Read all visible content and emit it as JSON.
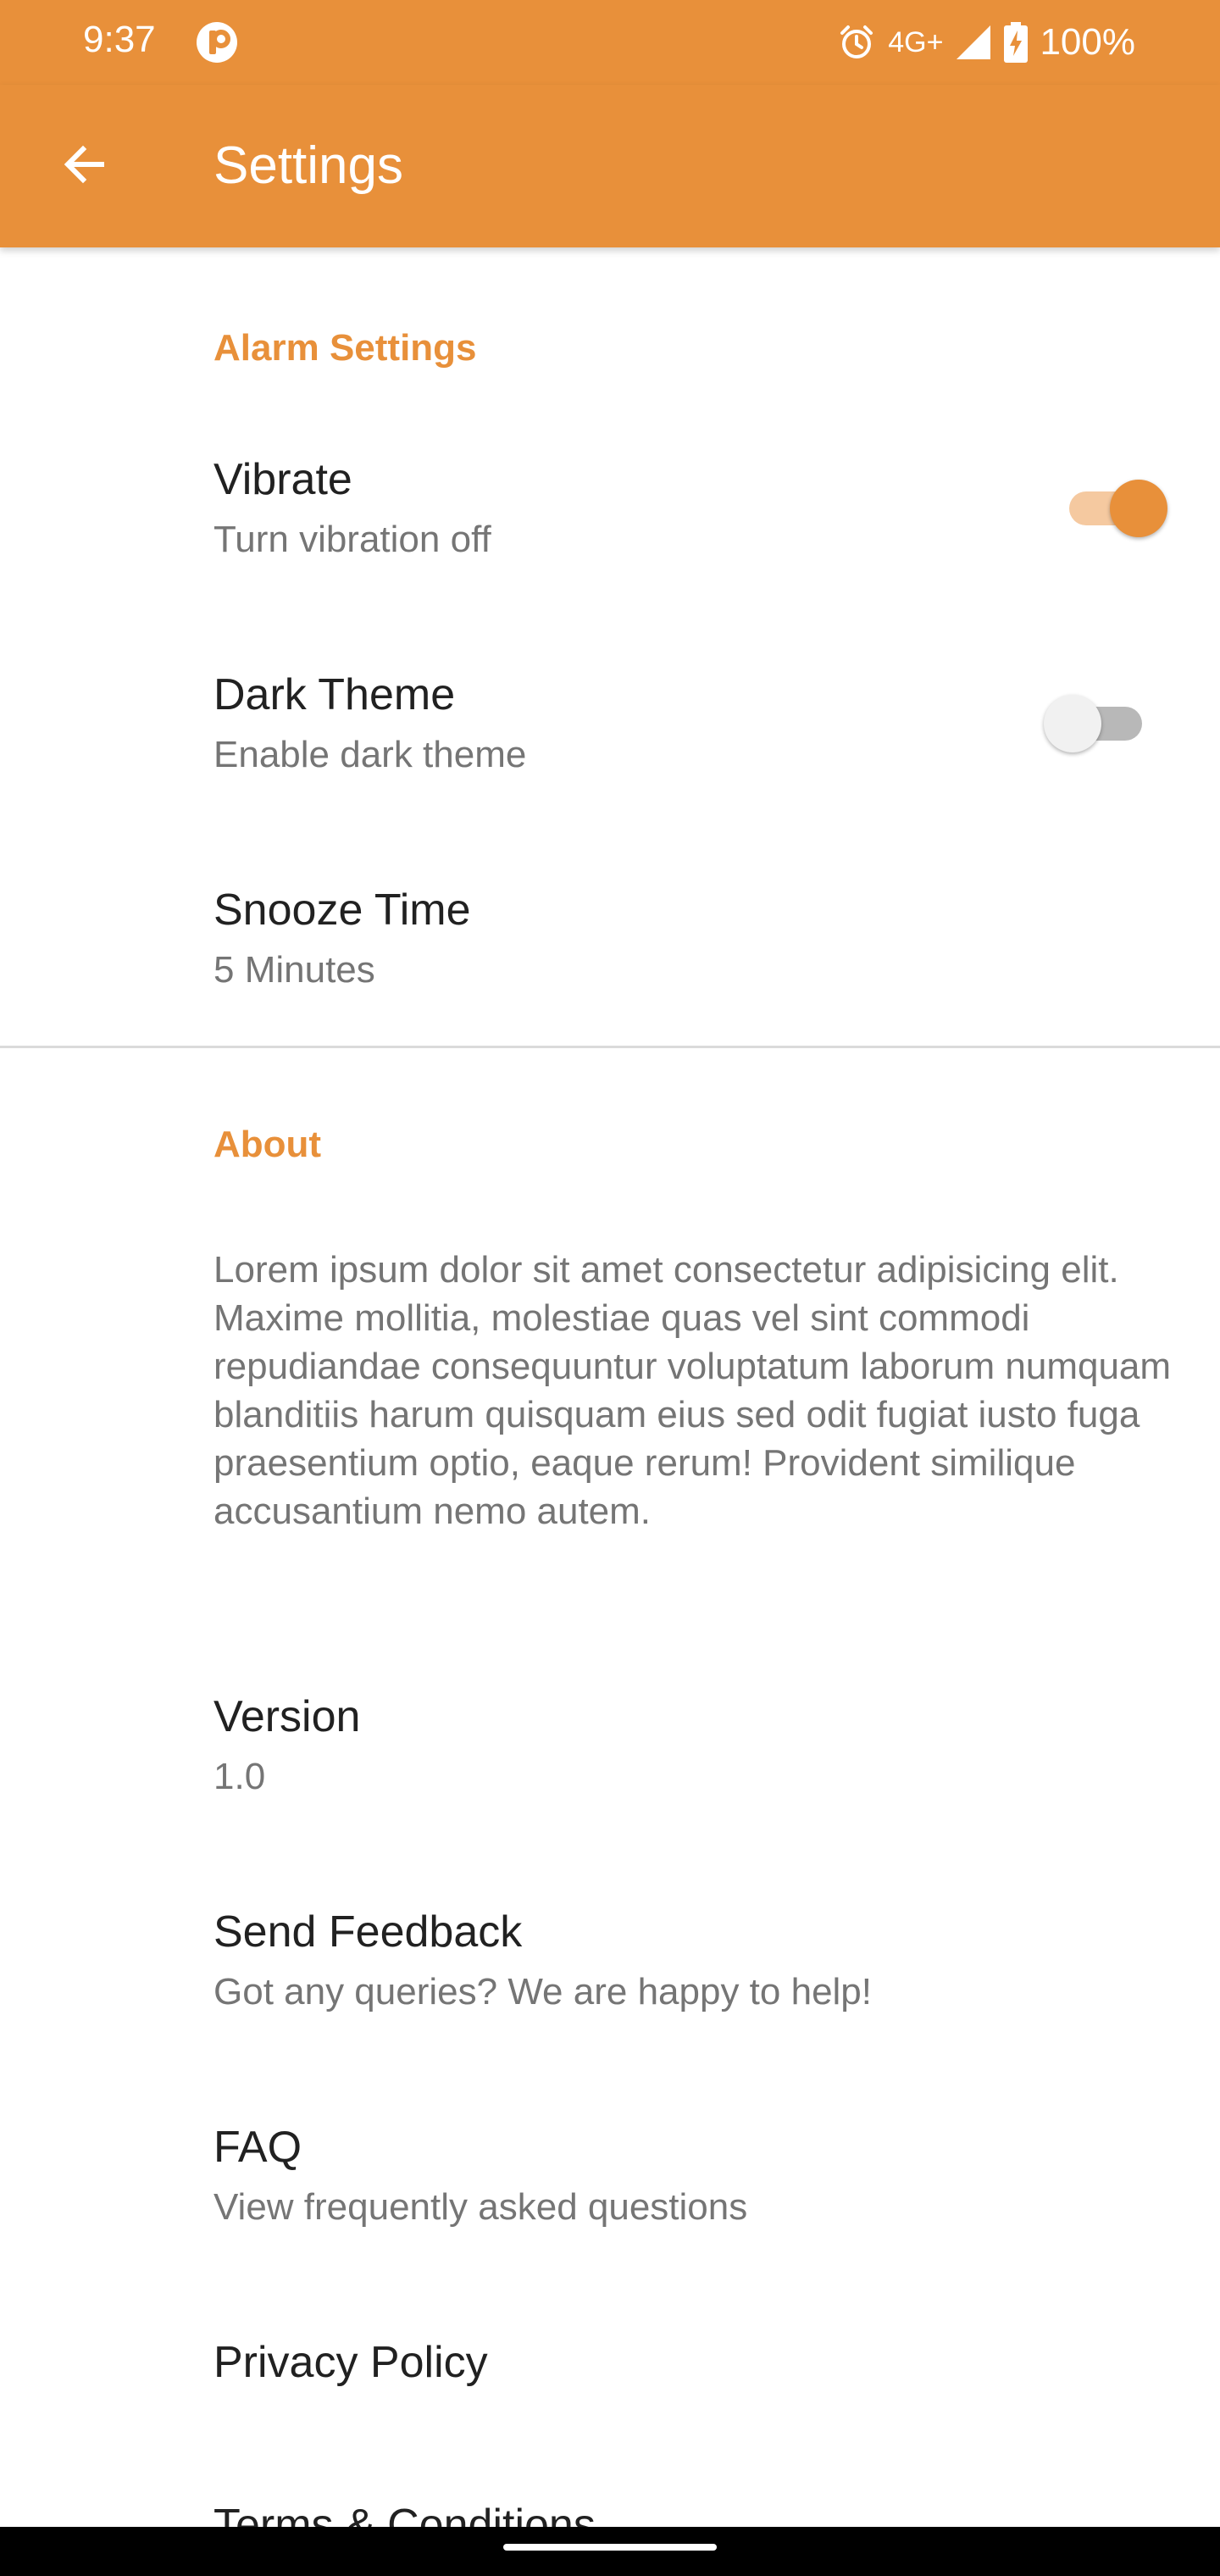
{
  "status_bar": {
    "time": "9:37",
    "network": "4G+",
    "battery": "100%",
    "icons": [
      "app-notification-icon",
      "alarm-icon",
      "signal-icon",
      "battery-charging-icon"
    ]
  },
  "app_bar": {
    "title": "Settings",
    "back_icon": "arrow-back-icon",
    "color": "#E8903A"
  },
  "alarm_section": {
    "title": "Alarm Settings",
    "vibrate": {
      "title": "Vibrate",
      "summary": "Turn vibration off",
      "enabled": true
    },
    "dark_theme": {
      "title": "Dark Theme",
      "summary": "Enable dark theme",
      "enabled": false
    },
    "snooze": {
      "title": "Snooze Time",
      "summary": "5 Minutes"
    }
  },
  "about_section": {
    "title": "About",
    "description": "Lorem ipsum dolor sit amet consectetur adipisicing elit. Maxime mollitia, molestiae quas vel sint commodi repudiandae consequuntur voluptatum laborum numquam blanditiis harum quisquam eius sed odit fugiat iusto fuga praesentium optio, eaque rerum! Provident similique accusantium nemo autem.",
    "version": {
      "title": "Version",
      "summary": "1.0"
    },
    "feedback": {
      "title": "Send Feedback",
      "summary": "Got any queries? We are happy to help!"
    },
    "faq": {
      "title": "FAQ",
      "summary": "View frequently asked questions"
    },
    "privacy": {
      "title": "Privacy Policy"
    },
    "terms": {
      "title": "Terms & Conditions"
    }
  },
  "colors": {
    "accent": "#E8903A",
    "primary_text": "#212121",
    "secondary_text": "#757575"
  }
}
